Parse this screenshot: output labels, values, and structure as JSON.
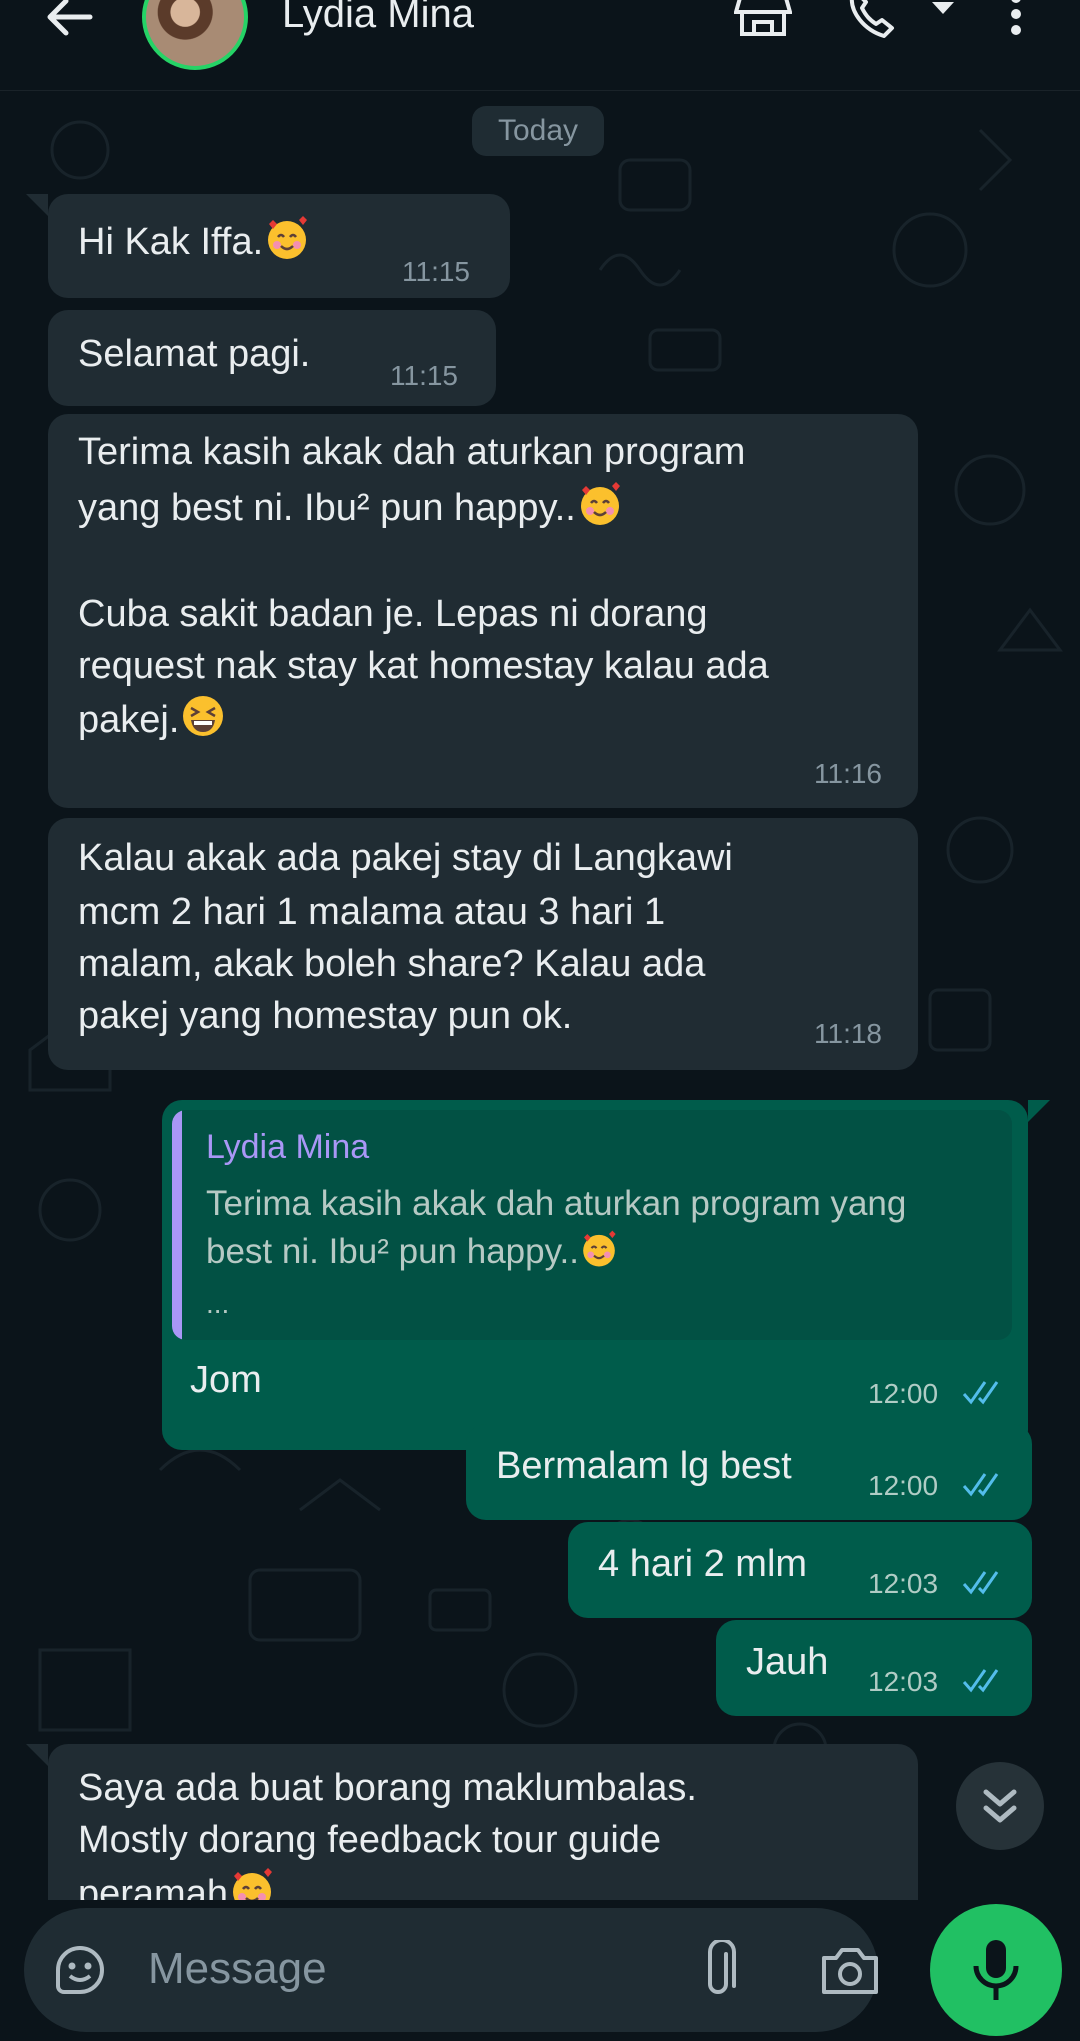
{
  "header": {
    "back_icon": "arrow-left-icon",
    "contact_name": "Lydia Mina",
    "icons": [
      "storefront-icon",
      "phone-icon",
      "dropdown-caret-icon",
      "more-vertical-icon"
    ]
  },
  "chat": {
    "date_label": "Today",
    "messages": [
      {
        "direction": "in",
        "lines": [
          "Hi Kak Iffa."
        ],
        "emoji": "smiling-face-with-hearts",
        "time": "11:15"
      },
      {
        "direction": "in",
        "lines": [
          "Selamat pagi."
        ],
        "time": "11:15"
      },
      {
        "direction": "in",
        "lines": [
          "Terima kasih akak dah aturkan program",
          "yang best ni. Ibu² pun happy..",
          "",
          "Cuba sakit badan je. Lepas ni dorang",
          "request nak stay kat homestay kalau ada",
          "pakej."
        ],
        "emoji": [
          "smiling-face-with-hearts",
          "grinning-squinting-face"
        ],
        "time": "11:16"
      },
      {
        "direction": "in",
        "lines": [
          "Kalau akak ada pakej stay di Langkawi",
          "mcm 2 hari 1 malama atau 3 hari 1",
          "malam, akak boleh share? Kalau ada",
          "pakej yang homestay pun ok."
        ],
        "time": "11:18"
      },
      {
        "direction": "out",
        "reply_to": {
          "author": "Lydia Mina",
          "lines": [
            "Terima kasih akak dah aturkan program yang",
            "best ni. Ibu² pun happy.."
          ],
          "ellipsis": "..."
        },
        "lines": [
          "Jom"
        ],
        "time": "12:00",
        "status": "read"
      },
      {
        "direction": "out",
        "lines": [
          "Bermalam lg best"
        ],
        "time": "12:00",
        "status": "read"
      },
      {
        "direction": "out",
        "lines": [
          "4 hari 2 mlm"
        ],
        "time": "12:03",
        "status": "read"
      },
      {
        "direction": "out",
        "lines": [
          "Jauh"
        ],
        "time": "12:03",
        "status": "read"
      },
      {
        "direction": "in",
        "lines": [
          "Saya ada buat borang maklumbalas.",
          "Mostly dorang feedback tour guide",
          "peramah"
        ],
        "partial": true
      }
    ]
  },
  "scroll_button_icon": "double-chevron-down-icon",
  "composer": {
    "sticker_icon": "sticker-icon",
    "placeholder": "Message",
    "attach_icon": "paperclip-icon",
    "camera_icon": "camera-icon",
    "mic_icon": "microphone-icon"
  },
  "colors": {
    "background": "#0b141a",
    "incoming_bubble": "#202c33",
    "outgoing_bubble": "#005c4b",
    "read_ticks": "#53bdeb",
    "accent_green": "#21c063",
    "quote_author": "#a997f6"
  }
}
